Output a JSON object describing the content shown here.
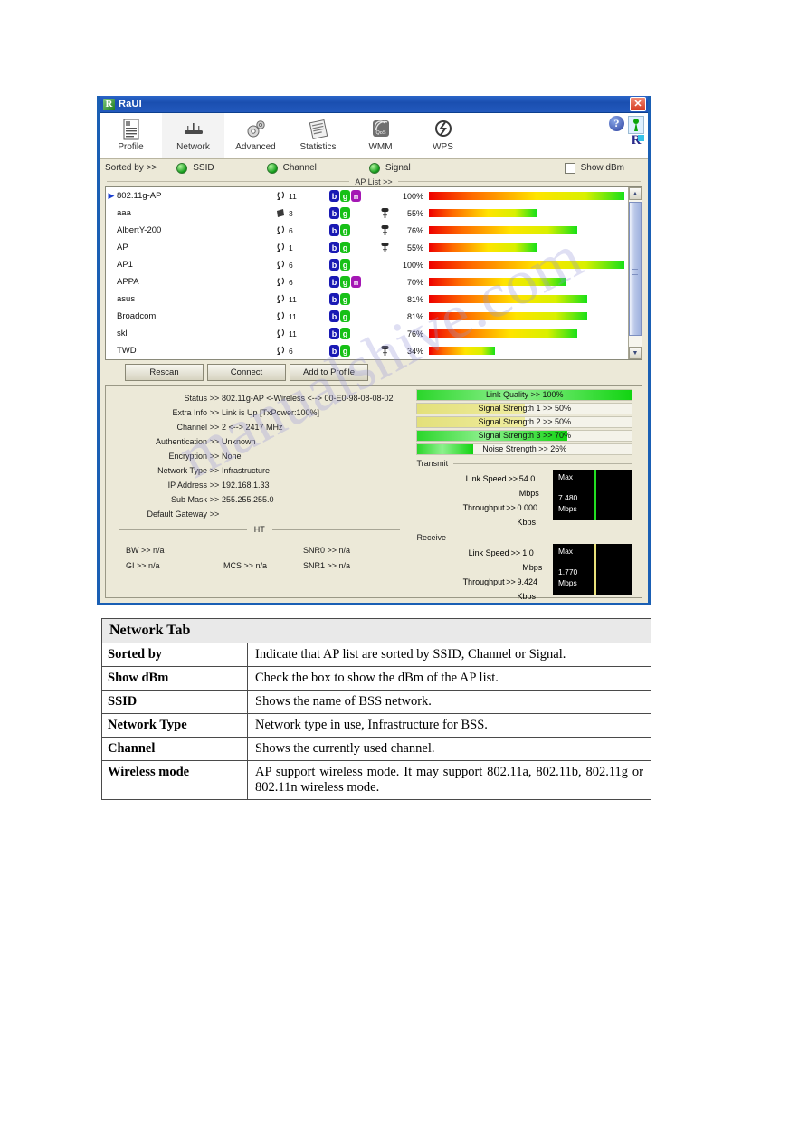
{
  "window": {
    "title": "RaUI",
    "logo_icon": "ralink-logo-icon",
    "close_label": "✕"
  },
  "toolbar": {
    "items": [
      {
        "label": "Profile",
        "icon": "profile-icon",
        "active": false
      },
      {
        "label": "Network",
        "icon": "network-icon",
        "active": true
      },
      {
        "label": "Advanced",
        "icon": "advanced-icon",
        "active": false
      },
      {
        "label": "Statistics",
        "icon": "statistics-icon",
        "active": false
      },
      {
        "label": "WMM",
        "icon": "wmm-qos-icon",
        "active": false
      },
      {
        "label": "WPS",
        "icon": "wps-icon",
        "active": false
      }
    ],
    "help_label": "?",
    "tray_icon": "signal-tray-icon",
    "brand_mark": "R"
  },
  "sortbar": {
    "label": "Sorted by >>",
    "options": [
      "SSID",
      "Channel",
      "Signal"
    ],
    "show_dbm_label": "Show dBm",
    "show_dbm_checked": false
  },
  "aplist": {
    "section_label": "AP List >>",
    "rows": [
      {
        "selected": true,
        "ssid": "802.11g-AP",
        "channel": "11",
        "channel_icon": "channel-icon",
        "modes": [
          "b",
          "g",
          "n"
        ],
        "secured": false,
        "signal": "100%",
        "signal_pct": 100
      },
      {
        "selected": false,
        "ssid": "aaa",
        "channel": "3",
        "channel_icon": "channel-icon-alt",
        "modes": [
          "b",
          "g"
        ],
        "secured": true,
        "signal": "55%",
        "signal_pct": 55
      },
      {
        "selected": false,
        "ssid": "AlbertY-200",
        "channel": "6",
        "channel_icon": "channel-icon",
        "modes": [
          "b",
          "g"
        ],
        "secured": true,
        "signal": "76%",
        "signal_pct": 76
      },
      {
        "selected": false,
        "ssid": "AP",
        "channel": "1",
        "channel_icon": "channel-icon",
        "modes": [
          "b",
          "g"
        ],
        "secured": true,
        "signal": "55%",
        "signal_pct": 55
      },
      {
        "selected": false,
        "ssid": "AP1",
        "channel": "6",
        "channel_icon": "channel-icon",
        "modes": [
          "b",
          "g"
        ],
        "secured": false,
        "signal": "100%",
        "signal_pct": 100
      },
      {
        "selected": false,
        "ssid": "APPA",
        "channel": "6",
        "channel_icon": "channel-icon",
        "modes": [
          "b",
          "g",
          "n"
        ],
        "secured": false,
        "signal": "70%",
        "signal_pct": 70
      },
      {
        "selected": false,
        "ssid": "asus",
        "channel": "11",
        "channel_icon": "channel-icon",
        "modes": [
          "b",
          "g"
        ],
        "secured": false,
        "signal": "81%",
        "signal_pct": 81
      },
      {
        "selected": false,
        "ssid": "Broadcom",
        "channel": "11",
        "channel_icon": "channel-icon",
        "modes": [
          "b",
          "g"
        ],
        "secured": false,
        "signal": "81%",
        "signal_pct": 81
      },
      {
        "selected": false,
        "ssid": "skl",
        "channel": "11",
        "channel_icon": "channel-icon",
        "modes": [
          "b",
          "g"
        ],
        "secured": false,
        "signal": "76%",
        "signal_pct": 76
      },
      {
        "selected": false,
        "ssid": "TWD",
        "channel": "6",
        "channel_icon": "channel-icon",
        "modes": [
          "b",
          "g"
        ],
        "secured": true,
        "signal": "34%",
        "signal_pct": 34
      }
    ]
  },
  "buttons": {
    "rescan": "Rescan",
    "connect": "Connect",
    "add_to_profile": "Add to Profile"
  },
  "details": {
    "fields": [
      {
        "key": "Status",
        "arrow": ">>",
        "value": "802.11g-AP <-Wireless  <--> 00-E0-98-08-08-02"
      },
      {
        "key": "Extra Info",
        "arrow": ">>",
        "value": "Link is Up [TxPower:100%]"
      },
      {
        "key": "Channel",
        "arrow": ">>",
        "value": "2 <--> 2417 MHz"
      },
      {
        "key": "Authentication",
        "arrow": ">>",
        "value": "Unknown"
      },
      {
        "key": "Encryption",
        "arrow": ">>",
        "value": "None"
      },
      {
        "key": "Network Type",
        "arrow": ">>",
        "value": "Infrastructure"
      },
      {
        "key": "IP Address",
        "arrow": ">>",
        "value": "192.168.1.33"
      },
      {
        "key": "Sub Mask",
        "arrow": ">>",
        "value": "255.255.255.0"
      },
      {
        "key": "Default Gateway",
        "arrow": ">>",
        "value": ""
      }
    ],
    "ht_label": "HT",
    "ht": {
      "bw": "BW >> n/a",
      "gi": "GI >> n/a",
      "mcs": "MCS >> n/a",
      "snr0": "SNR0 >> n/a",
      "snr1": "SNR1 >> n/a"
    },
    "meters": [
      {
        "label": "Link Quality >> 100%",
        "pct": 100,
        "style": "green"
      },
      {
        "label": "Signal Strength 1 >> 50%",
        "pct": 50,
        "style": "yellow"
      },
      {
        "label": "Signal Strength 2 >> 50%",
        "pct": 50,
        "style": "yellow"
      },
      {
        "label": "Signal Strength 3 >> 70%",
        "pct": 70,
        "style": "green"
      },
      {
        "label": "Noise Strength >> 26%",
        "pct": 26,
        "style": "green"
      }
    ],
    "transmit": {
      "title": "Transmit",
      "link_speed_key": "Link Speed",
      "link_speed_arrow": ">>",
      "link_speed_value": "54.0 Mbps",
      "throughput_key": "Throughput",
      "throughput_arrow": ">>",
      "throughput_value": "0.000 Kbps",
      "max_label": "Max",
      "max_value": "7.480",
      "max_unit": "Mbps",
      "needle_color": "#22dd22"
    },
    "receive": {
      "title": "Receive",
      "link_speed_key": "Link Speed",
      "link_speed_arrow": ">>",
      "link_speed_value": "1.0 Mbps",
      "throughput_key": "Throughput",
      "throughput_arrow": ">>",
      "throughput_value": "9.424 Kbps",
      "max_label": "Max",
      "max_value": "1.770",
      "max_unit": "Mbps",
      "needle_color": "#e8e07a"
    }
  },
  "description_table": {
    "heading": "Network Tab",
    "rows": [
      {
        "term": "Sorted by",
        "definition": "Indicate that AP list are sorted by SSID, Channel or Signal."
      },
      {
        "term": "Show dBm",
        "definition": "Check the box to show the dBm of the AP list."
      },
      {
        "term": "SSID",
        "definition": "Shows the name of BSS network."
      },
      {
        "term": "Network Type",
        "definition": "Network type in use, Infrastructure for BSS."
      },
      {
        "term": "Channel",
        "definition": "Shows the currently used channel."
      },
      {
        "term": "Wireless mode",
        "definition": "AP support wireless mode. It may support 802.11a, 802.11b, 802.11g or 802.11n wireless mode."
      }
    ]
  },
  "watermark": {
    "text": "manualshive.com"
  }
}
